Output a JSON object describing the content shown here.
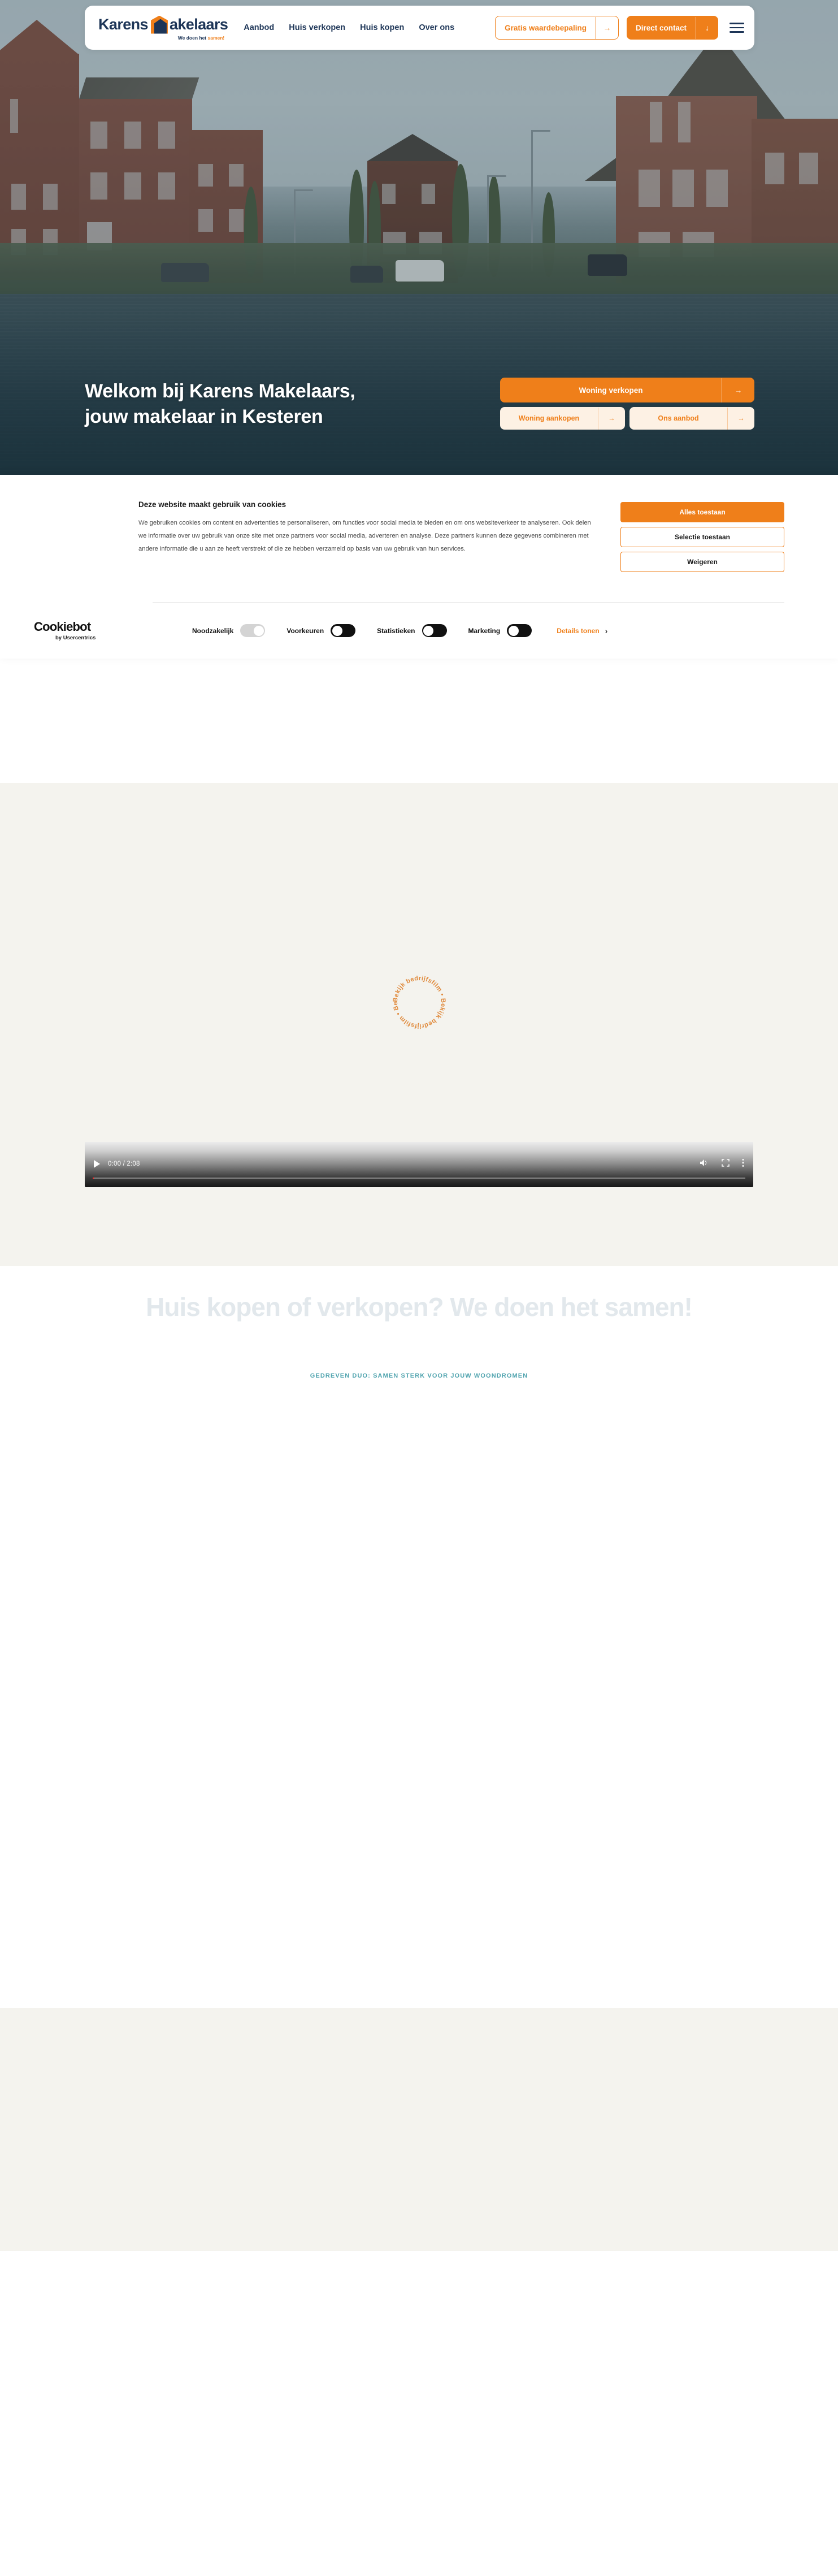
{
  "brand": {
    "name_part1": "Karens",
    "name_part2": "akelaars",
    "tagline_pre": "We doen het ",
    "tagline_accent": "samen!",
    "accent_color": "#ef7f1a",
    "navy_color": "#1d3557",
    "teal_color": "#4fa3ae"
  },
  "nav": {
    "links": [
      {
        "label": "Aanbod"
      },
      {
        "label": "Huis verkopen"
      },
      {
        "label": "Huis kopen"
      },
      {
        "label": "Over ons"
      }
    ],
    "valuation_button": {
      "label": "Gratis waardebepaling",
      "icon": "→"
    },
    "contact_button": {
      "label": "Direct contact",
      "icon": "↓"
    },
    "menu_icon": "hamburger-menu-icon"
  },
  "hero": {
    "title_line1": "Welkom bij Karens Makelaars,",
    "title_line2": "jouw makelaar in Kesteren",
    "cta_primary": {
      "label": "Woning verkopen",
      "icon": "→"
    },
    "cta_secondary": {
      "label": "Woning aankopen",
      "icon": "→"
    },
    "cta_tertiary": {
      "label": "Ons aanbod",
      "icon": "→"
    }
  },
  "cookie": {
    "title": "Deze website maakt gebruik van cookies",
    "body": "We gebruiken cookies om content en advertenties te personaliseren, om functies voor social media te bieden en om ons websiteverkeer te analyseren. Ook delen we informatie over uw gebruik van onze site met onze partners voor social media, adverteren en analyse. Deze partners kunnen deze gegevens combineren met andere informatie die u aan ze heeft verstrekt of die ze hebben verzameld op basis van uw gebruik van hun services.",
    "buttons": [
      {
        "label": "Alles toestaan",
        "style": "fill"
      },
      {
        "label": "Selectie toestaan",
        "style": "ghost"
      },
      {
        "label": "Weigeren",
        "style": "ghost"
      }
    ],
    "provider_name": "Cookiebot",
    "provider_sub": "by Usercentrics",
    "toggles": [
      {
        "label": "Noodzakelijk",
        "state": "off_locked"
      },
      {
        "label": "Voorkeuren",
        "state": "on"
      },
      {
        "label": "Statistieken",
        "state": "on"
      },
      {
        "label": "Marketing",
        "state": "on"
      }
    ],
    "details_label": "Details tonen",
    "details_chevron": "›"
  },
  "video": {
    "badge_text": "Bekijk bedrijfsfilm • Bekijk bedrijfsfilm • ",
    "current_time": "0:00",
    "duration": "2:08",
    "time_display": "0:00 / 2:08",
    "icons": {
      "play": "play-icon",
      "volume": "volume-icon",
      "fullscreen": "fullscreen-icon",
      "more": "more-options-icon"
    }
  },
  "headline": {
    "heading": "Huis kopen of verkopen? We doen het samen!",
    "kicker": "GEDREVEN DUO: SAMEN STERK VOOR JOUW WOONDROMEN"
  }
}
